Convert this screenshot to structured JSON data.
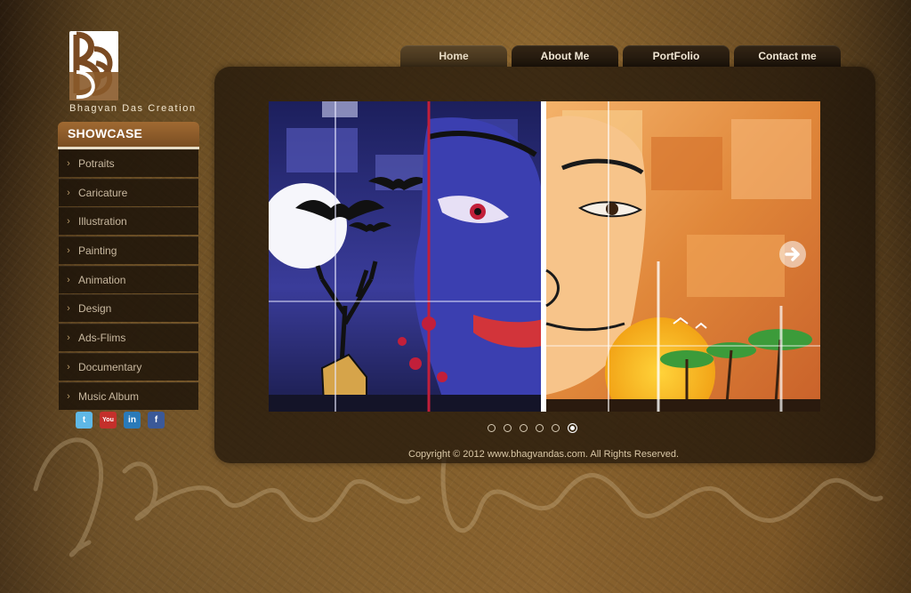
{
  "brand": {
    "name": "Bhagvan Das Creation",
    "logo_icon": "bd-monogram-icon"
  },
  "nav": {
    "tabs": [
      {
        "label": "Home",
        "active": true
      },
      {
        "label": "About Me",
        "active": false
      },
      {
        "label": "PortFolio",
        "active": false
      },
      {
        "label": "Contact me",
        "active": false
      }
    ]
  },
  "sidebar": {
    "heading": "SHOWCASE",
    "items": [
      {
        "label": "Potraits"
      },
      {
        "label": "Caricature"
      },
      {
        "label": "Illustration"
      },
      {
        "label": "Painting"
      },
      {
        "label": "Animation"
      },
      {
        "label": "Design"
      },
      {
        "label": "Ads-Flims"
      },
      {
        "label": "Documentary"
      },
      {
        "label": "Music Album"
      }
    ]
  },
  "social": [
    {
      "icon": "twitter-icon",
      "glyph": "t",
      "color": "#5fb8e6"
    },
    {
      "icon": "youtube-icon",
      "glyph": "You",
      "color": "#c4302b"
    },
    {
      "icon": "linkedin-icon",
      "glyph": "in",
      "color": "#2a7ab8"
    },
    {
      "icon": "facebook-icon",
      "glyph": "f",
      "color": "#3b5998"
    }
  ],
  "slider": {
    "image_icon": "artwork-slide-image",
    "next_icon": "arrow-right-icon",
    "total_slides": 6,
    "current_slide": 6
  },
  "footer": {
    "copyright": "Copyright © 2012 www.bhagvandas.com. All Rights Reserved."
  },
  "colors": {
    "accent": "#8a5a2a",
    "panel": "#1c1208",
    "text_light": "#f0e6d4"
  }
}
